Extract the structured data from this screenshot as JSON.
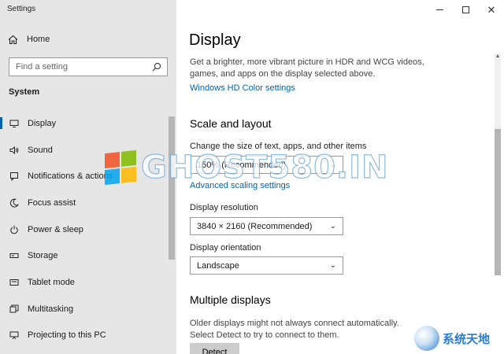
{
  "window": {
    "title": "Settings",
    "minimize_icon": "minimize-icon",
    "maximize_icon": "maximize-icon",
    "close_icon": "close-icon"
  },
  "sidebar": {
    "home_label": "Home",
    "search_placeholder": "Find a setting",
    "section": "System",
    "items": [
      {
        "label": "Display",
        "icon": "monitor-icon",
        "active": true
      },
      {
        "label": "Sound",
        "icon": "speaker-icon",
        "active": false
      },
      {
        "label": "Notifications & actions",
        "icon": "notification-icon",
        "active": false
      },
      {
        "label": "Focus assist",
        "icon": "moon-icon",
        "active": false
      },
      {
        "label": "Power & sleep",
        "icon": "power-icon",
        "active": false
      },
      {
        "label": "Storage",
        "icon": "storage-icon",
        "active": false
      },
      {
        "label": "Tablet mode",
        "icon": "tablet-icon",
        "active": false
      },
      {
        "label": "Multitasking",
        "icon": "multitasking-icon",
        "active": false
      },
      {
        "label": "Projecting to this PC",
        "icon": "projector-icon",
        "active": false
      }
    ]
  },
  "main": {
    "title": "Display",
    "description": "Get a brighter, more vibrant picture in HDR and WCG videos, games, and apps on the display selected above.",
    "hd_link": "Windows HD Color settings",
    "scale": {
      "heading": "Scale and layout",
      "label": "Change the size of text, apps, and other items",
      "value": "150% (Recommended)",
      "advanced_link": "Advanced scaling settings"
    },
    "resolution": {
      "label": "Display resolution",
      "value": "3840 × 2160 (Recommended)"
    },
    "orientation": {
      "label": "Display orientation",
      "value": "Landscape"
    },
    "multiple": {
      "heading": "Multiple displays",
      "description": "Older displays might not always connect automatically. Select Detect to try to connect to them.",
      "detect_label": "Detect"
    }
  },
  "watermark": {
    "text": "GHOST580.IN",
    "corner_text": "系统天地"
  }
}
